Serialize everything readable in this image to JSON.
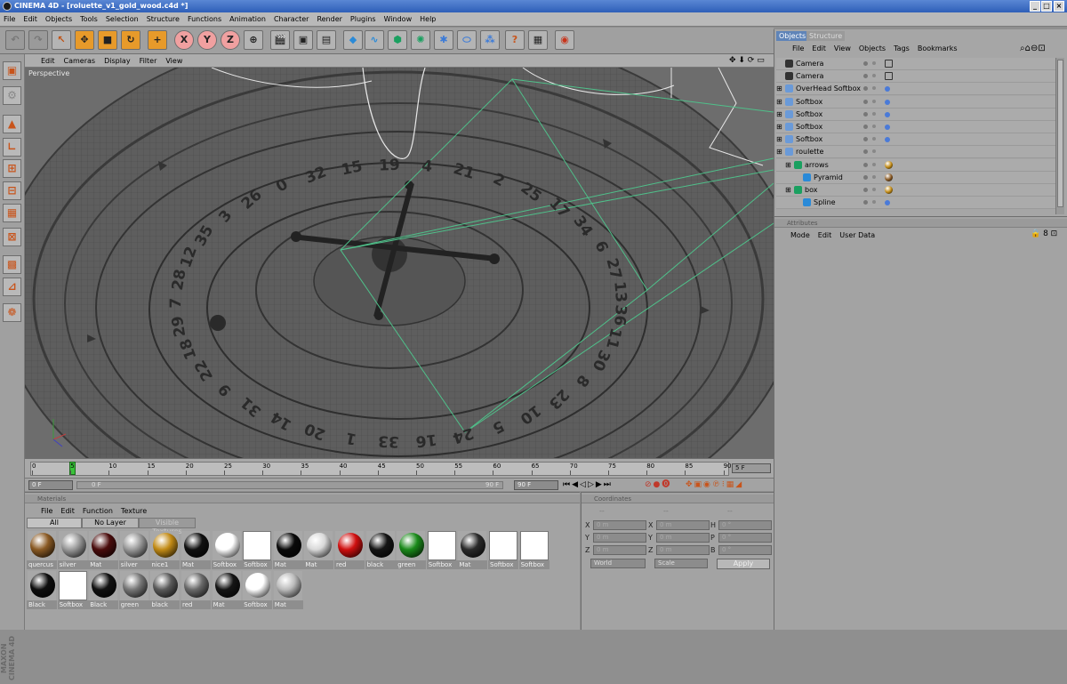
{
  "window": {
    "title": "CINEMA 4D - [roluette_v1_gold_wood.c4d *]"
  },
  "menu": [
    "File",
    "Edit",
    "Objects",
    "Tools",
    "Selection",
    "Structure",
    "Functions",
    "Animation",
    "Character",
    "Render",
    "Plugins",
    "Window",
    "Help"
  ],
  "toolbar": {
    "x_label": "X",
    "y_label": "Y",
    "z_label": "Z"
  },
  "viewport": {
    "menu": [
      "Edit",
      "Cameras",
      "Display",
      "Filter",
      "View"
    ],
    "label": "Perspective",
    "wheel_numbers": [
      "0",
      "32",
      "15",
      "19",
      "4",
      "21",
      "2",
      "25",
      "17",
      "34",
      "6",
      "27",
      "13",
      "36",
      "11",
      "30",
      "8",
      "23",
      "10",
      "5",
      "24",
      "16",
      "33",
      "1",
      "20",
      "14",
      "31",
      "9",
      "22",
      "18",
      "29",
      "7",
      "28",
      "12",
      "35",
      "3",
      "26"
    ]
  },
  "timeline": {
    "ticks": [
      "0",
      "5",
      "10",
      "15",
      "20",
      "25",
      "30",
      "35",
      "40",
      "45",
      "50",
      "55",
      "60",
      "65",
      "70",
      "75",
      "80",
      "85",
      "90"
    ],
    "current_frame": "5 F",
    "start_field": "0 F",
    "mid_field": "0 F",
    "end_field": "90 F",
    "end_field2": "90 F"
  },
  "materials": {
    "title": "Materials",
    "menu": [
      "File",
      "Edit",
      "Function",
      "Texture"
    ],
    "tabs": [
      "All",
      "No Layer",
      "Visible Textures"
    ],
    "items": [
      {
        "name": "quercus",
        "kind": "ball",
        "color": "#8a5a24"
      },
      {
        "name": "silver",
        "kind": "ball",
        "color": "#9a9a9a"
      },
      {
        "name": "Mat",
        "kind": "ball",
        "color": "#4a0c0c"
      },
      {
        "name": "silver",
        "kind": "ball",
        "color": "#9a9a9a"
      },
      {
        "name": "nice1",
        "kind": "ball",
        "color": "#c28b16"
      },
      {
        "name": "Mat",
        "kind": "ball",
        "color": "#111111"
      },
      {
        "name": "Softbox",
        "kind": "ball",
        "color": "#ffffff"
      },
      {
        "name": "Softbox",
        "kind": "square",
        "color": "#ffffff"
      },
      {
        "name": "Mat",
        "kind": "ball",
        "color": "#0a0a0a"
      },
      {
        "name": "Mat",
        "kind": "ball",
        "color": "#d8d8d8"
      },
      {
        "name": "red",
        "kind": "ball",
        "color": "#d01010"
      },
      {
        "name": "black",
        "kind": "ball",
        "color": "#151515"
      },
      {
        "name": "green",
        "kind": "ball",
        "color": "#1a8a1a"
      },
      {
        "name": "Softbox",
        "kind": "square",
        "color": "#ffffff"
      },
      {
        "name": "Mat",
        "kind": "ball",
        "color": "#2a2a2a"
      },
      {
        "name": "Softbox",
        "kind": "square",
        "color": "#ffffff"
      },
      {
        "name": "Softbox",
        "kind": "square",
        "color": "#ffffff"
      },
      {
        "name": "Black",
        "kind": "ball",
        "color": "#0e0e0e"
      },
      {
        "name": "Softbox",
        "kind": "square",
        "color": "#ffffff"
      },
      {
        "name": "Black",
        "kind": "ball",
        "color": "#111111"
      },
      {
        "name": "green",
        "kind": "ball",
        "color": "#777777"
      },
      {
        "name": "black",
        "kind": "ball",
        "color": "#5a5a5a"
      },
      {
        "name": "red",
        "kind": "ball",
        "color": "#6a6a6a"
      },
      {
        "name": "Mat",
        "kind": "ball",
        "color": "#151515"
      },
      {
        "name": "Softbox",
        "kind": "ball",
        "color": "#ffffff"
      },
      {
        "name": "Mat",
        "kind": "ball",
        "color": "#bbbbbb"
      }
    ]
  },
  "coordinates": {
    "title": "Coordinates",
    "pos_label": "X",
    "y_label": "Y",
    "z_label": "Z",
    "h_label": "H",
    "p_label": "P",
    "b_label": "B",
    "pos_values": [
      "0 m",
      "0 m",
      "0 m"
    ],
    "size_values": [
      "0 m",
      "0 m",
      "0 m"
    ],
    "rot_values": [
      "0 °",
      "0 °",
      "0 °"
    ],
    "dash": "--",
    "world_select": "World",
    "scale_select": "Scale",
    "apply": "Apply"
  },
  "objects": {
    "tabs": [
      "Objects",
      "Structure"
    ],
    "menu": [
      "File",
      "Edit",
      "View",
      "Objects",
      "Tags",
      "Bookmarks"
    ],
    "rows": [
      {
        "name": "Camera",
        "indent": 0
      },
      {
        "name": "Camera",
        "indent": 0
      },
      {
        "name": "OverHead Softbox",
        "indent": 0
      },
      {
        "name": "Softbox",
        "indent": 0
      },
      {
        "name": "Softbox",
        "indent": 0
      },
      {
        "name": "Softbox",
        "indent": 0
      },
      {
        "name": "Softbox",
        "indent": 0
      },
      {
        "name": "roulette",
        "indent": 0
      },
      {
        "name": "arrows",
        "indent": 1
      },
      {
        "name": "Pyramid",
        "indent": 2
      },
      {
        "name": "box",
        "indent": 1
      },
      {
        "name": "Spline",
        "indent": 2
      }
    ]
  },
  "attributes": {
    "title": "Attributes",
    "menu": [
      "Mode",
      "Edit",
      "User Data"
    ]
  },
  "logo": "MAXON CINEMA 4D"
}
